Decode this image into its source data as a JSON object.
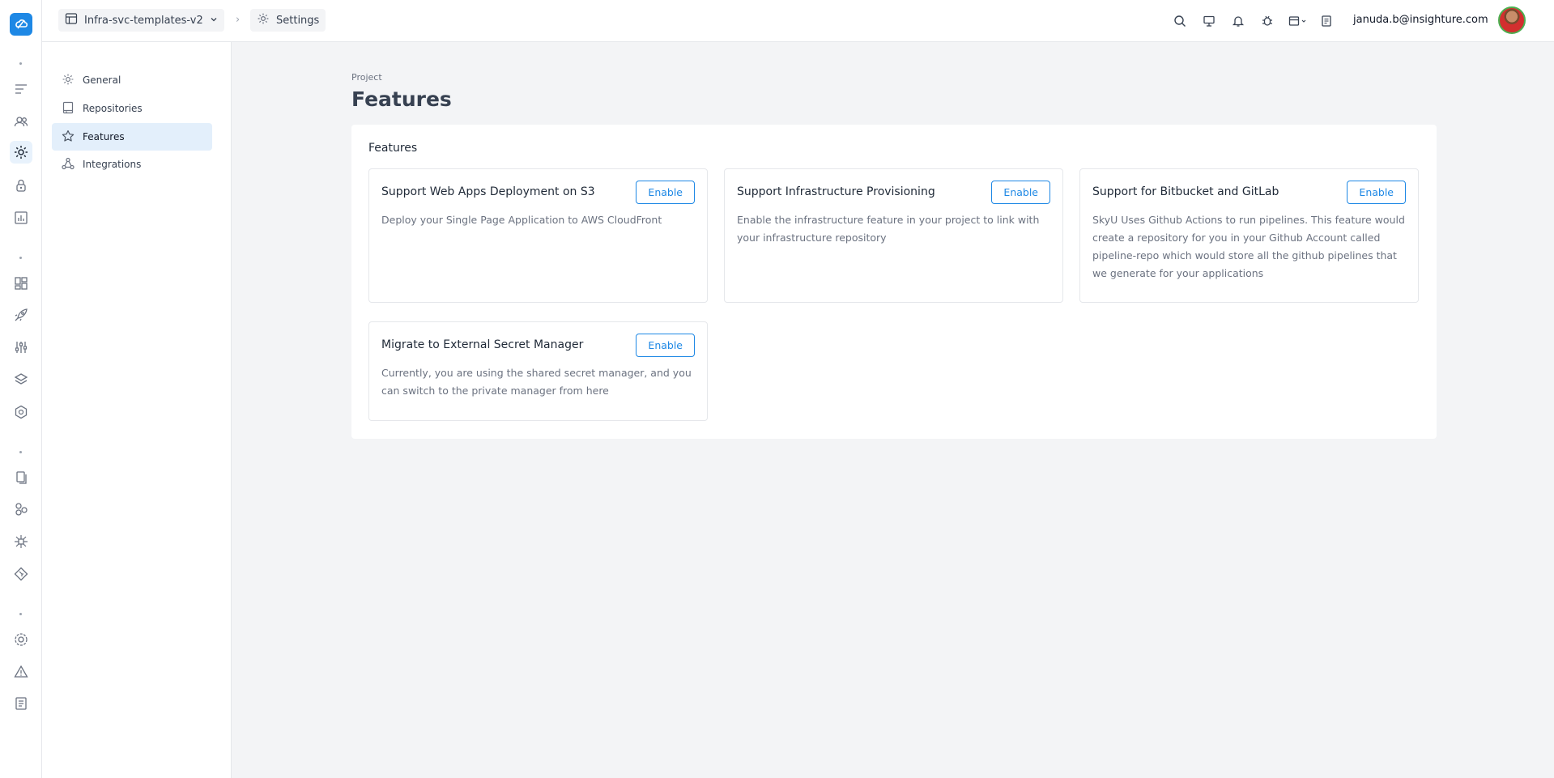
{
  "topbar": {
    "project_name": "Infra-svc-templates-v2",
    "breadcrumb_separator": "›",
    "current_section": "Settings",
    "user_email": "januda.b@insighture.com"
  },
  "settings_nav": {
    "items": [
      {
        "label": "General",
        "icon": "gear-icon"
      },
      {
        "label": "Repositories",
        "icon": "repository-icon"
      },
      {
        "label": "Features",
        "icon": "star-icon",
        "active": true
      },
      {
        "label": "Integrations",
        "icon": "integrations-icon"
      }
    ]
  },
  "main": {
    "eyebrow": "Project",
    "title": "Features",
    "panel_title": "Features",
    "cards": [
      {
        "title": "Support Web Apps Deployment on S3",
        "description": "Deploy your Single Page Application to AWS CloudFront",
        "button": "Enable"
      },
      {
        "title": "Support Infrastructure Provisioning",
        "description": "Enable the infrastructure feature in your project to link with your infrastructure repository",
        "button": "Enable"
      },
      {
        "title": "Support for Bitbucket and GitLab",
        "description": "SkyU Uses Github Actions to run pipelines. This feature would create a repository for you in your Github Account called pipeline-repo which would store all the github pipelines that we generate for your applications",
        "button": "Enable"
      },
      {
        "title": "Migrate to External Secret Manager",
        "description": "Currently, you are using the shared secret manager, and you can switch to the private manager from here",
        "button": "Enable"
      }
    ]
  },
  "colors": {
    "accent": "#1e88e5",
    "active_nav_bg": "#e3effb",
    "main_bg": "#f3f4f6"
  }
}
